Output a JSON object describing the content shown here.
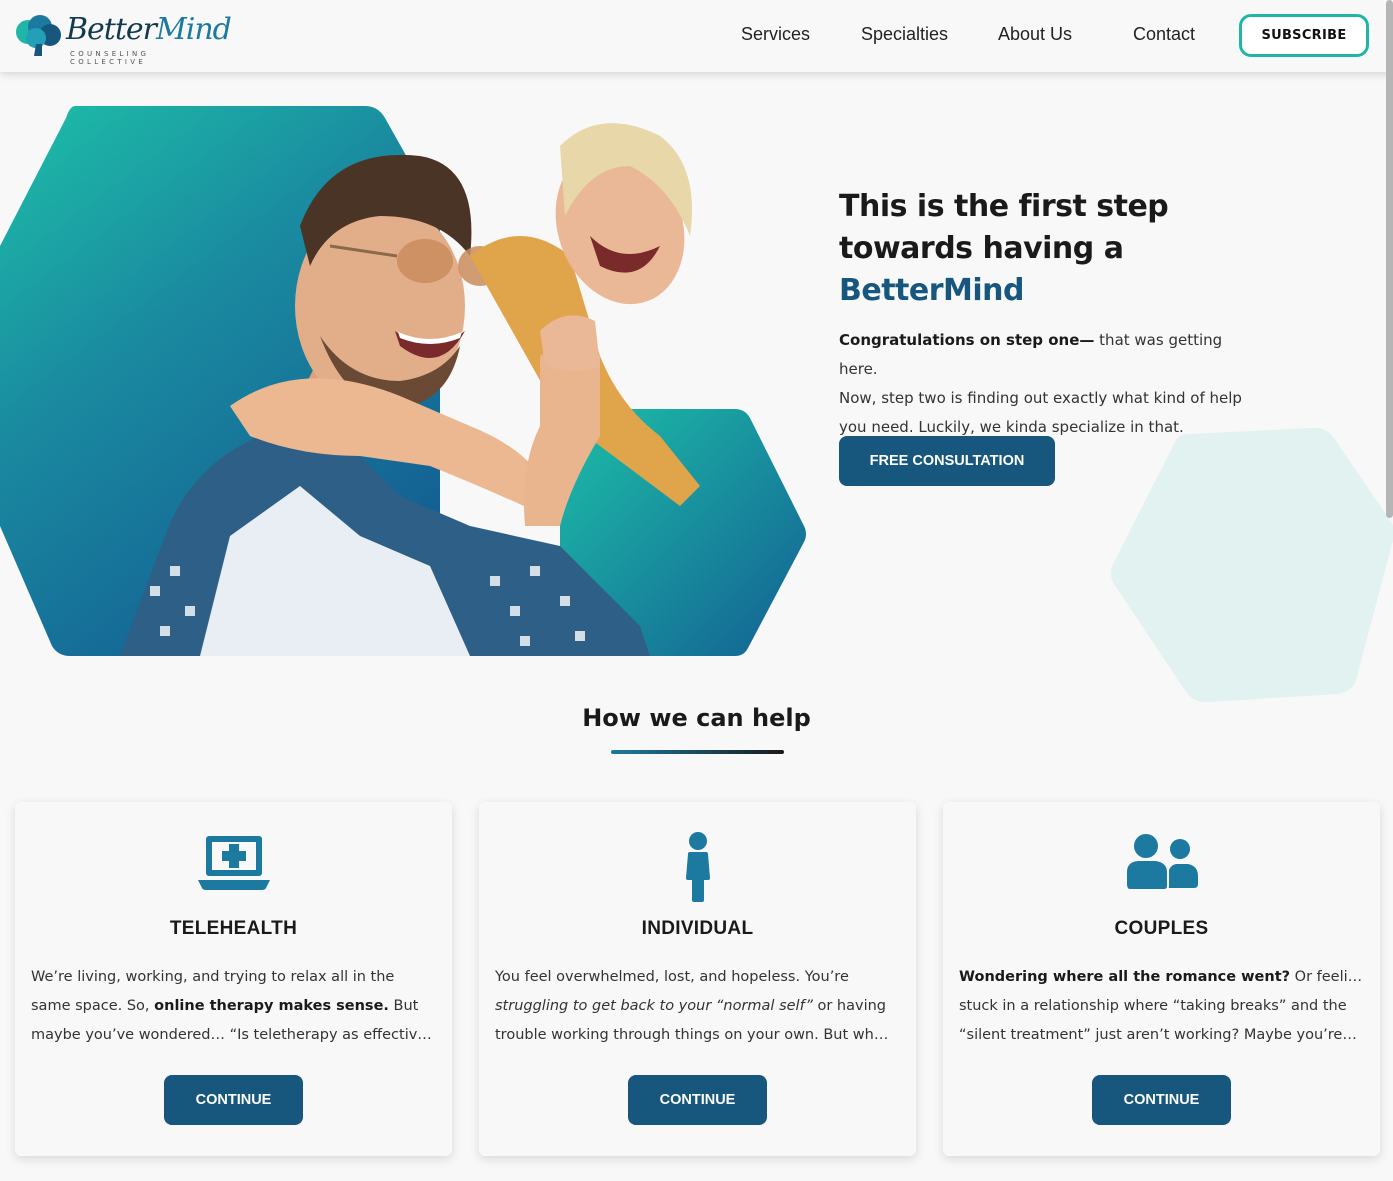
{
  "header": {
    "logo_text_a": "Better",
    "logo_text_b": "Mind",
    "logo_tagline": "COUNSELING COLLECTIVE",
    "nav": [
      "Services",
      "Specialties",
      "About Us",
      "Contact"
    ],
    "subscribe_label": "SUBSCRIBE"
  },
  "hero": {
    "title_line1": "This is the first step",
    "title_line2": "towards having a",
    "title_brand": "BetterMind",
    "body_bold": "Congratulations on step one—",
    "body_rest_1": " that was getting here.",
    "body_line2": "Now, step two is finding out exactly what kind of help",
    "body_line3": "you need. Luckily, we kinda specialize in that.",
    "cta_label": "FREE CONSULTATION"
  },
  "help": {
    "title": "How we can help",
    "cards": [
      {
        "title": "TELEHEALTH",
        "icon": "telehealth-laptop-icon",
        "line1": "We’re living, working, and trying to relax all in the",
        "line2_a": "same space. So, ",
        "line2_b": "online therapy makes sense.",
        "line2_c": " But",
        "line3": "maybe you’ve wondered… “Is teletherapy as effectiv…",
        "button": "CONTINUE"
      },
      {
        "title": "INDIVIDUAL",
        "icon": "person-icon",
        "line1": "You feel overwhelmed, lost, and hopeless. You’re",
        "line2_a": "struggling to get back to your “normal self”",
        "line2_b": " or having",
        "line3": "trouble working through things on your own. But wh…",
        "button": "CONTINUE"
      },
      {
        "title": "COUPLES",
        "icon": "couple-icon",
        "line1_a": "Wondering where all the romance went?",
        "line1_b": " Or feeling",
        "line2": "stuck in a relationship where “taking breaks” and the",
        "line3": "“silent treatment” just aren’t working? Maybe you’re…",
        "button": "CONTINUE"
      }
    ]
  },
  "colors": {
    "brand_dark": "#17567d",
    "teal": "#1fb6a8",
    "icon_blue": "#1c7aa0"
  }
}
